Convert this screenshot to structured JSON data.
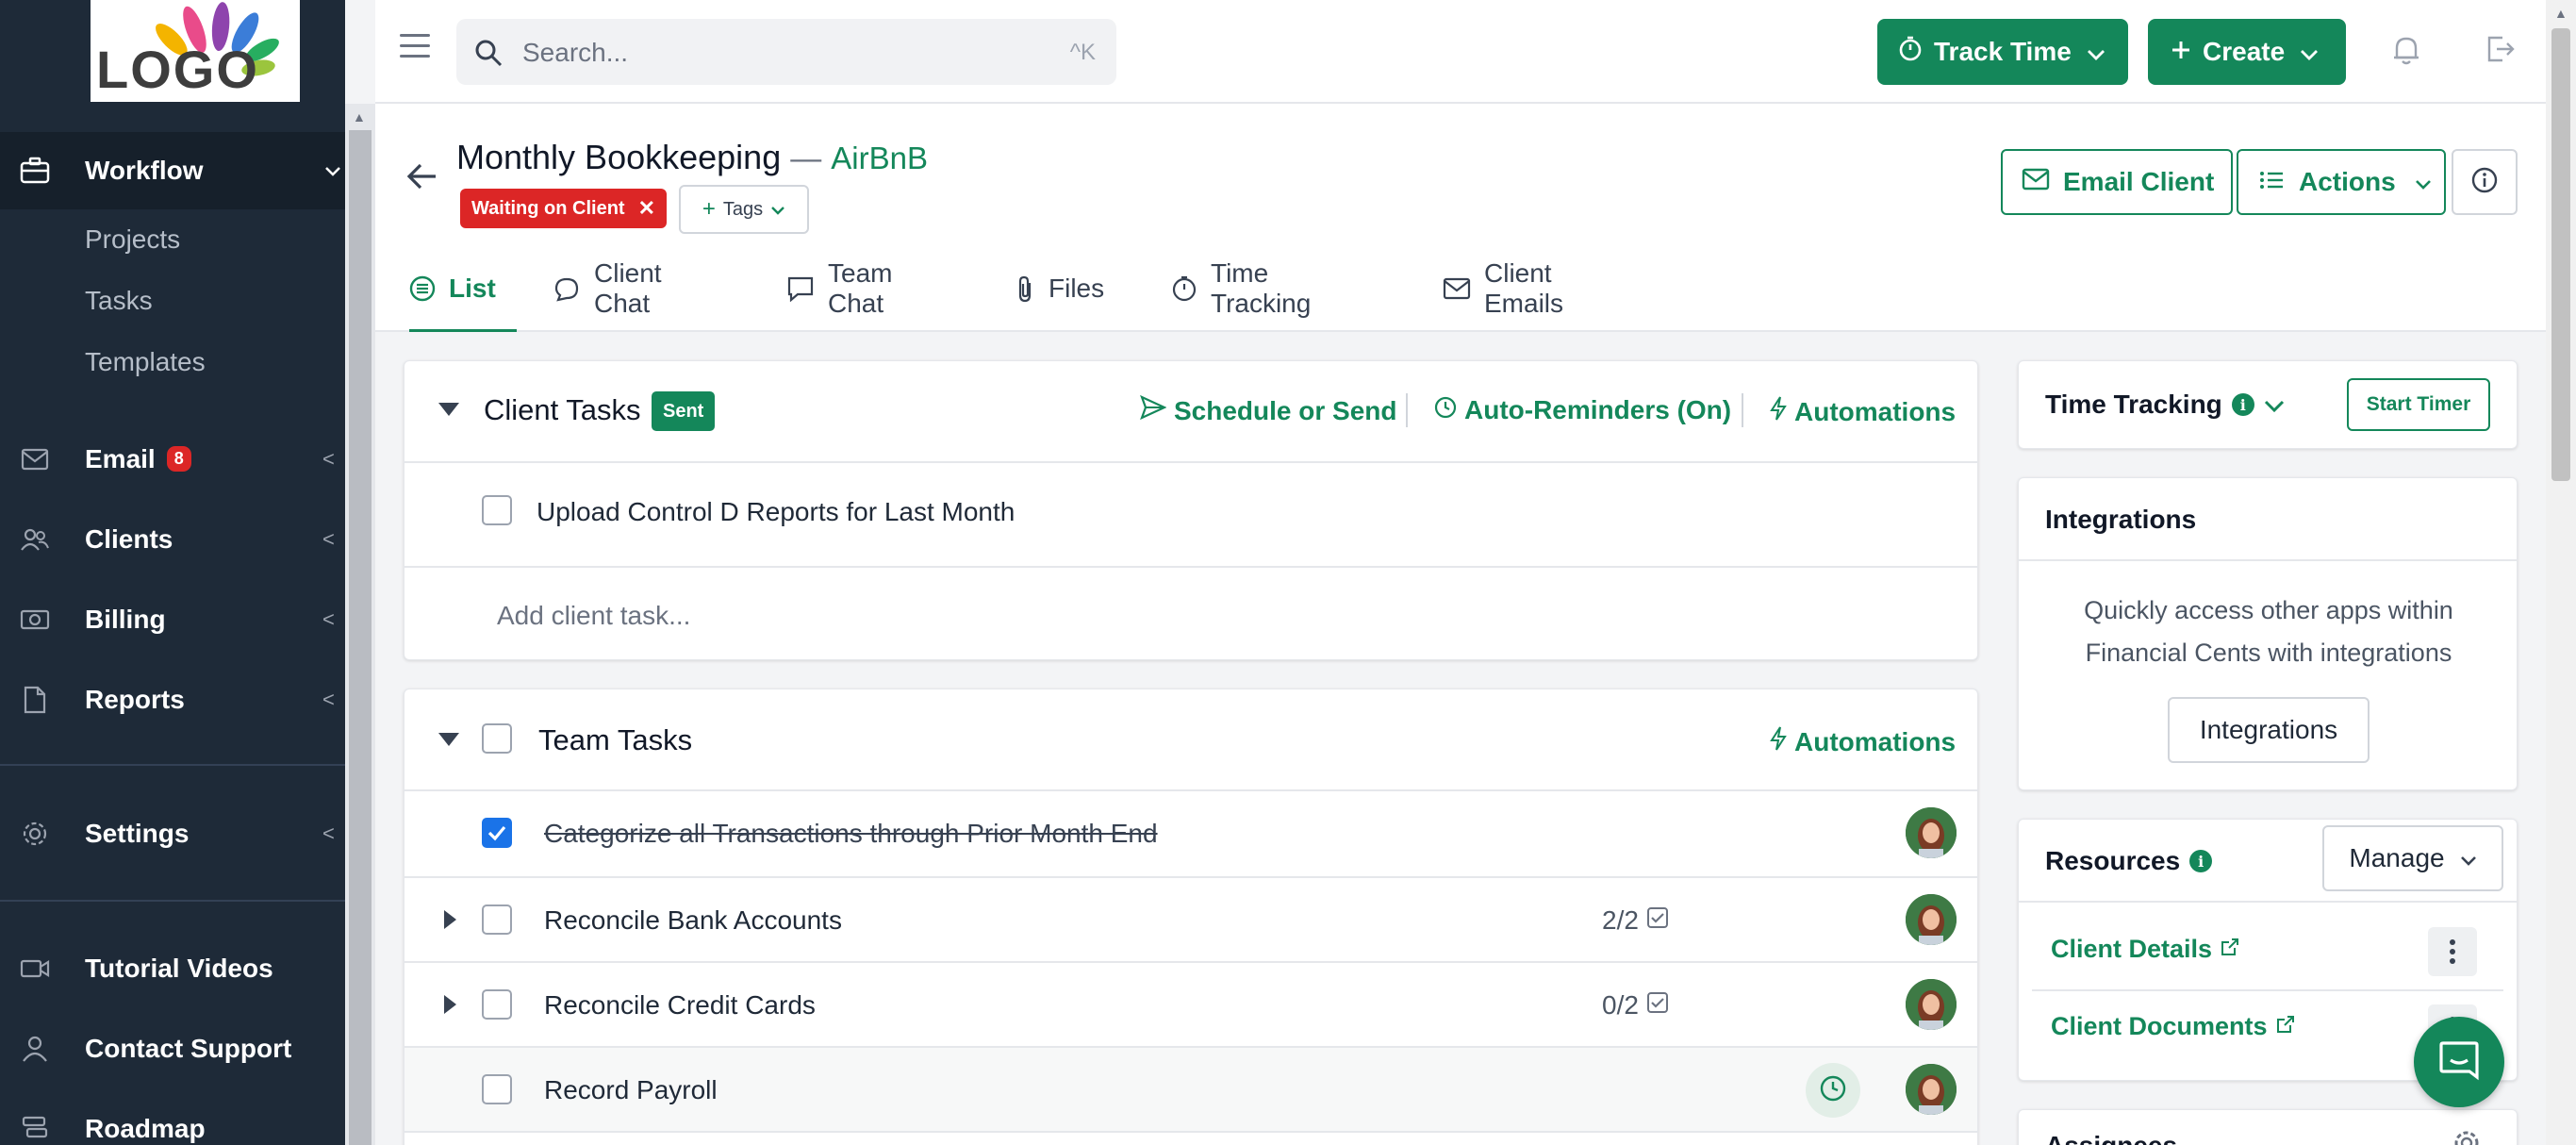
{
  "logo": {
    "text": "LOGO"
  },
  "sidebar": {
    "workflow": {
      "label": "Workflow",
      "chevron": "v",
      "icon": "briefcase-icon"
    },
    "workflow_sub": [
      "Projects",
      "Tasks",
      "Templates"
    ],
    "email": {
      "label": "Email",
      "badge": "8",
      "chevron": "<",
      "icon": "mail-icon"
    },
    "clients": {
      "label": "Clients",
      "chevron": "<",
      "icon": "users-icon"
    },
    "billing": {
      "label": "Billing",
      "chevron": "<",
      "icon": "money-icon"
    },
    "reports": {
      "label": "Reports",
      "chevron": "<",
      "icon": "file-icon"
    },
    "settings": {
      "label": "Settings",
      "chevron": "<",
      "icon": "gear-icon"
    },
    "tutorial": {
      "label": "Tutorial Videos",
      "icon": "video-icon"
    },
    "support": {
      "label": "Contact Support",
      "icon": "person-icon"
    },
    "roadmap": {
      "label": "Roadmap",
      "icon": "roadmap-icon"
    }
  },
  "topbar": {
    "search_placeholder": "Search...",
    "search_shortcut": "^K",
    "track_time": "Track Time",
    "create": "Create"
  },
  "project": {
    "title": "Monthly Bookkeeping",
    "dash": "—",
    "client": "AirBnB",
    "status": "Waiting on Client",
    "tags_label": "Tags",
    "email_client": "Email Client",
    "actions": "Actions"
  },
  "tabs": [
    "List",
    "Client Chat",
    "Team Chat",
    "Files",
    "Time Tracking",
    "Client Emails"
  ],
  "client_tasks": {
    "title": "Client Tasks",
    "badge": "Sent",
    "schedule": "Schedule or Send",
    "reminders": "Auto-Reminders (On)",
    "automations": "Automations",
    "items": [
      "Upload Control D Reports for Last Month"
    ],
    "add_placeholder": "Add client task..."
  },
  "team_tasks": {
    "title": "Team Tasks",
    "automations": "Automations",
    "items": [
      {
        "label": "Categorize all Transactions through Prior Month End",
        "checked": true,
        "done": true
      },
      {
        "label": "Reconcile Bank Accounts",
        "subcount": "2/2",
        "expandable": true
      },
      {
        "label": "Reconcile Credit Cards",
        "subcount": "0/2",
        "expandable": true
      },
      {
        "label": "Record Payroll",
        "timer": true
      }
    ]
  },
  "time_tracking": {
    "title": "Time Tracking",
    "start_timer": "Start Timer"
  },
  "integrations": {
    "title": "Integrations",
    "desc": "Quickly access other apps within Financial Cents with integrations",
    "button": "Integrations"
  },
  "resources": {
    "title": "Resources",
    "manage": "Manage",
    "links": [
      "Client Details",
      "Client Documents"
    ]
  },
  "assignees": {
    "title": "Assignees"
  },
  "colors": {
    "brand": "#14875a",
    "sidebar": "#1e2a38",
    "status_red": "#dc2626",
    "check_blue": "#1a73e8"
  }
}
